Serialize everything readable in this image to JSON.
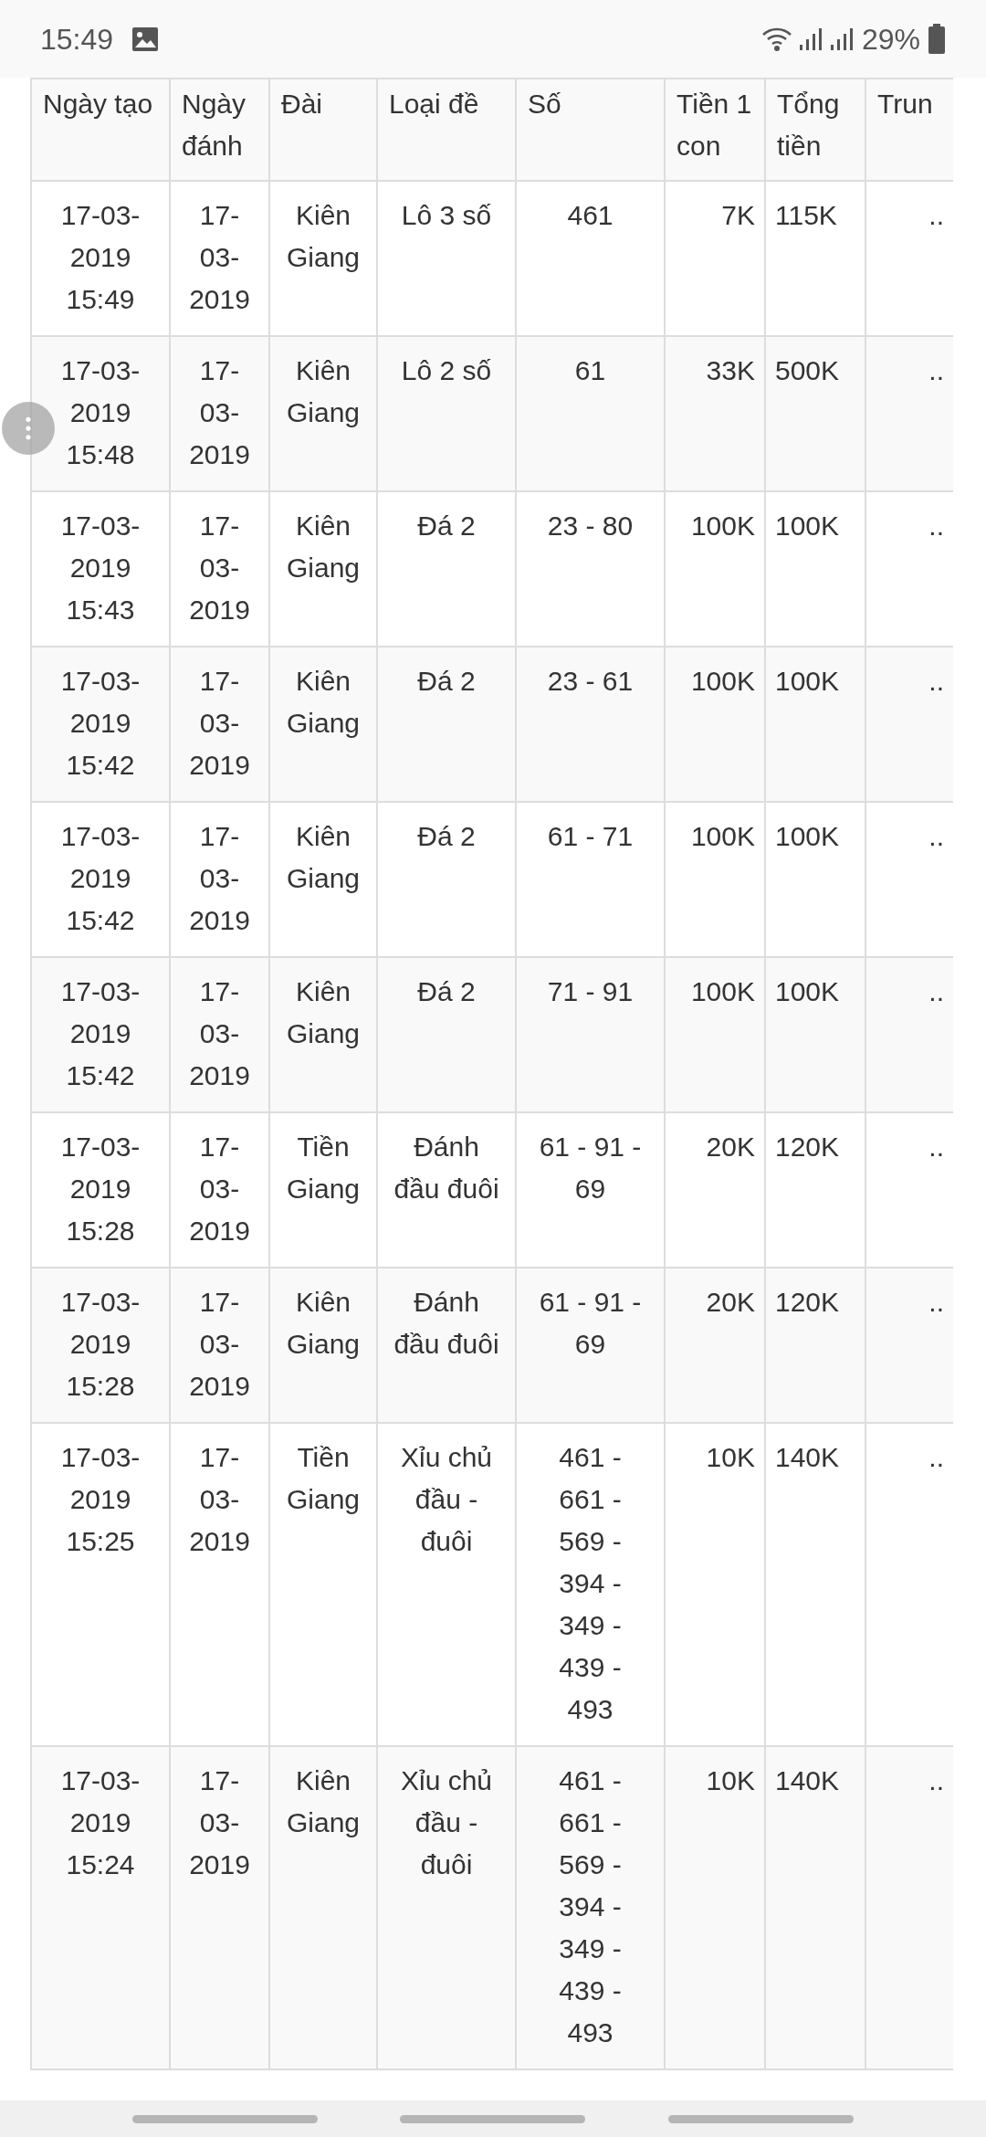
{
  "status_bar": {
    "time": "15:49",
    "battery": "29%"
  },
  "table": {
    "columns": [
      "Ngày tạo",
      "Ngày đánh",
      "Đài",
      "Loại đề",
      "Số",
      "Tiền 1 con",
      "Tổng tiền",
      "Trun"
    ],
    "rows": [
      {
        "created": "17-03-2019 15:49",
        "play_date": "17-03-2019",
        "station": "Kiên Giang",
        "type": "Lô 3 số",
        "numbers": "461",
        "per_unit": "7K",
        "total": "115K",
        "win": ".."
      },
      {
        "created": "17-03-2019 15:48",
        "play_date": "17-03-2019",
        "station": "Kiên Giang",
        "type": "Lô 2 số",
        "numbers": "61",
        "per_unit": "33K",
        "total": "500K",
        "win": ".."
      },
      {
        "created": "17-03-2019 15:43",
        "play_date": "17-03-2019",
        "station": "Kiên Giang",
        "type": "Đá 2",
        "numbers": "23 - 80",
        "per_unit": "100K",
        "total": "100K",
        "win": ".."
      },
      {
        "created": "17-03-2019 15:42",
        "play_date": "17-03-2019",
        "station": "Kiên Giang",
        "type": "Đá 2",
        "numbers": "23 - 61",
        "per_unit": "100K",
        "total": "100K",
        "win": ".."
      },
      {
        "created": "17-03-2019 15:42",
        "play_date": "17-03-2019",
        "station": "Kiên Giang",
        "type": "Đá 2",
        "numbers": "61 - 71",
        "per_unit": "100K",
        "total": "100K",
        "win": ".."
      },
      {
        "created": "17-03-2019 15:42",
        "play_date": "17-03-2019",
        "station": "Kiên Giang",
        "type": "Đá 2",
        "numbers": "71 - 91",
        "per_unit": "100K",
        "total": "100K",
        "win": ".."
      },
      {
        "created": "17-03-2019 15:28",
        "play_date": "17-03-2019",
        "station": "Tiền Giang",
        "type": "Đánh đầu đuôi",
        "numbers": "61 - 91 - 69",
        "per_unit": "20K",
        "total": "120K",
        "win": ".."
      },
      {
        "created": "17-03-2019 15:28",
        "play_date": "17-03-2019",
        "station": "Kiên Giang",
        "type": "Đánh đầu đuôi",
        "numbers": "61 - 91 - 69",
        "per_unit": "20K",
        "total": "120K",
        "win": ".."
      },
      {
        "created": "17-03-2019 15:25",
        "play_date": "17-03-2019",
        "station": "Tiền Giang",
        "type": "Xỉu chủ đầu - đuôi",
        "numbers": "461 - 661 - 569 - 394 - 349 - 439 - 493",
        "per_unit": "10K",
        "total": "140K",
        "win": ".."
      },
      {
        "created": "17-03-2019 15:24",
        "play_date": "17-03-2019",
        "station": "Kiên Giang",
        "type": "Xỉu chủ đầu - đuôi",
        "numbers": "461 - 661 - 569 - 394 - 349 - 439 - 493",
        "per_unit": "10K",
        "total": "140K",
        "win": ".."
      }
    ]
  }
}
